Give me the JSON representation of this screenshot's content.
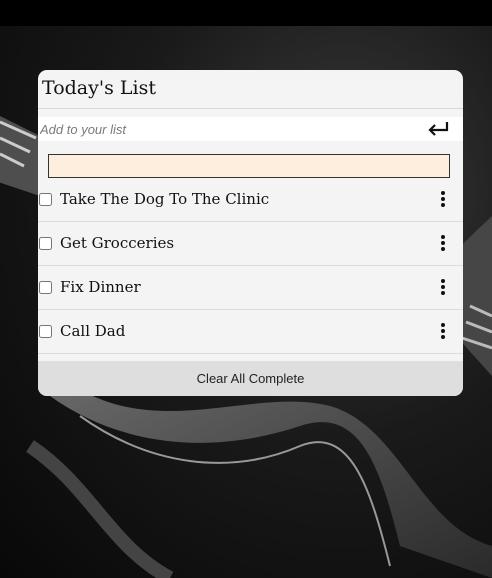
{
  "app": {
    "title": "Today's List"
  },
  "add": {
    "placeholder": "Add to your list",
    "value": "",
    "submit_icon": "enter-return-icon"
  },
  "editing": {
    "value": ""
  },
  "items": [
    {
      "label": "Take The Dog To The Clinic",
      "checked": false,
      "menu_icon": "vertical-ellipsis-icon"
    },
    {
      "label": "Get Grocceries",
      "checked": false,
      "menu_icon": "vertical-ellipsis-icon"
    },
    {
      "label": "Fix Dinner",
      "checked": false,
      "menu_icon": "vertical-ellipsis-icon"
    },
    {
      "label": "Call Dad",
      "checked": false,
      "menu_icon": "vertical-ellipsis-icon"
    }
  ],
  "footer": {
    "clear_label": "Clear All Complete"
  },
  "colors": {
    "card_bg": "#f4f4f4",
    "edit_bg": "#fdeedd",
    "footer_bg": "#dedede"
  }
}
